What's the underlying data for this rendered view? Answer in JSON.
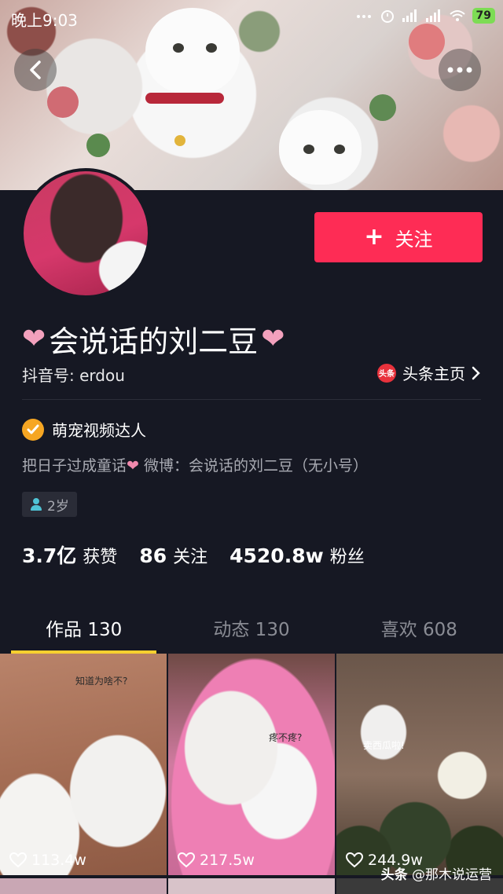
{
  "status_bar": {
    "time": "晚上9:03",
    "icons": "... ⏰ ▂▄▆ ▂▄▆ ",
    "battery": "79"
  },
  "profile": {
    "name_prefix": "❤",
    "name": "会说话的刘二豆",
    "name_suffix": "❤",
    "douyin_id": "抖音号: erdou",
    "toutiao_badge": "头条",
    "toutiao_link": "头条主页",
    "verified": "萌宠视频达人",
    "bio_left": "把日子过成童话",
    "bio_heart": "❤",
    "bio_right": " 微博：会说话的刘二豆（无小号）",
    "age": "2岁"
  },
  "follow_button": {
    "plus": "+",
    "label": "关注"
  },
  "stats": [
    {
      "num": "3.7亿",
      "label": "获赞"
    },
    {
      "num": "86",
      "label": "关注"
    },
    {
      "num": "4520.8w",
      "label": "粉丝"
    }
  ],
  "tabs": [
    {
      "label": "作品 130",
      "active": true
    },
    {
      "label": "动态 130",
      "active": false
    },
    {
      "label": "喜欢 608",
      "active": false
    }
  ],
  "videos": [
    {
      "caption": "知道为啥不?",
      "likes": "113.4w"
    },
    {
      "caption": "疼不疼?",
      "likes": "217.5w"
    },
    {
      "caption": "卖西瓜啦!",
      "likes": "244.9w"
    }
  ],
  "watermark": {
    "brand": "头条",
    "text": " @那木说运营"
  },
  "colors": {
    "background": "#161823",
    "follow": "#fe2c55",
    "tab_indicator": "#f8d02f",
    "verified": "#f6a623"
  }
}
